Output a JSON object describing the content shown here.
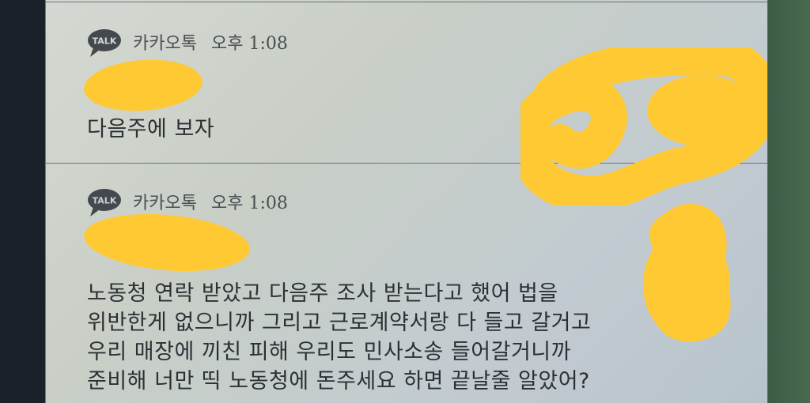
{
  "notifications": [
    {
      "app_name": "카카오톡",
      "time": "오후 1:08",
      "icon": "kakaotalk-talk-icon",
      "icon_text": "TALK",
      "message_lines": [
        "다음주에 보자"
      ]
    },
    {
      "app_name": "카카오톡",
      "time": "오후 1:08",
      "icon": "kakaotalk-talk-icon",
      "icon_text": "TALK",
      "message_lines": [
        "노동청 연락 받았고 다음주 조사 받는다고 했어 법을",
        "위반한게 없으니까 그리고 근로계약서랑 다 들고 갈거고",
        "우리 매장에 끼친 피해 우리도 민사소송 들어갈거니까",
        "준비해 너만 띡 노동청에 돈주세요 하면 끝날줄 알았어?"
      ]
    }
  ],
  "colors": {
    "redaction": "#ffc933",
    "text": "#2c3035",
    "meta": "#4a4e54"
  }
}
